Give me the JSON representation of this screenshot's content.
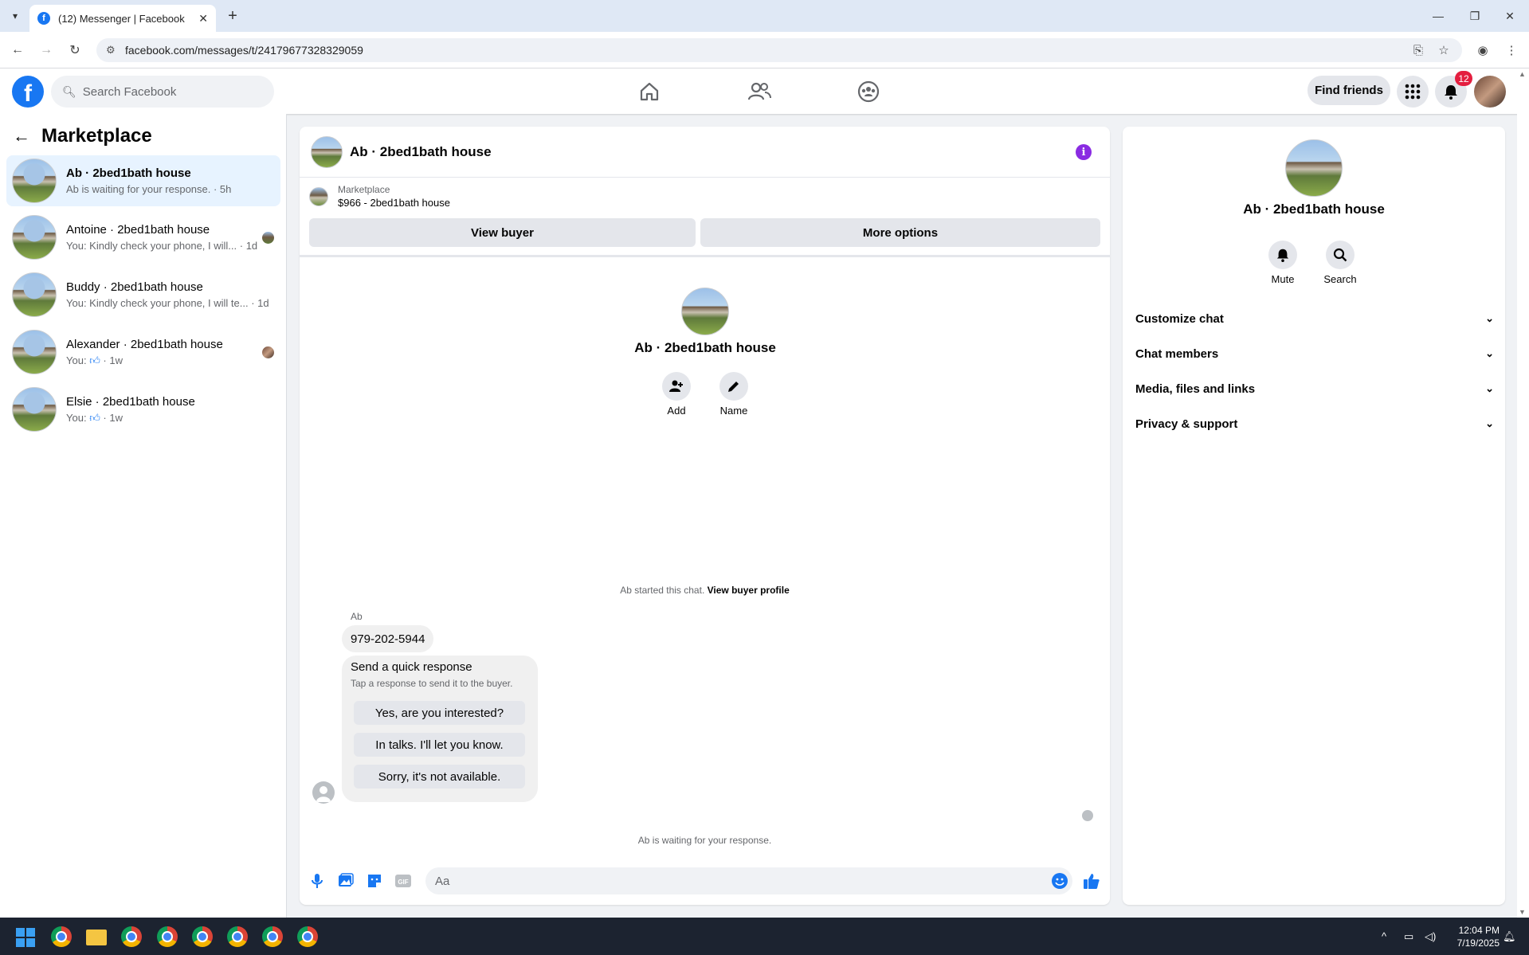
{
  "browser": {
    "tab_title": "(12) Messenger | Facebook",
    "url": "facebook.com/messages/t/24179677328329059"
  },
  "fb_nav": {
    "search_placeholder": "Search Facebook",
    "find_friends": "Find friends",
    "notification_count": "12"
  },
  "left_pane": {
    "title": "Marketplace",
    "chats": [
      {
        "name": "Ab · 2bed1bath house",
        "preview": "Ab is waiting for your response. · 5h"
      },
      {
        "name": "Antoine · 2bed1bath house",
        "preview": "You: Kindly check your phone, I will... · 1d"
      },
      {
        "name": "Buddy · 2bed1bath house",
        "preview": "You: Kindly check your phone, I will te... · 1d"
      },
      {
        "name": "Alexander · 2bed1bath house",
        "preview_prefix": "You:",
        "preview_suffix": "· 1w"
      },
      {
        "name": "Elsie · 2bed1bath house",
        "preview_prefix": "You:",
        "preview_suffix": "· 1w"
      }
    ]
  },
  "conversation": {
    "title": "Ab · 2bed1bath house",
    "marketplace_label": "Marketplace",
    "listing": "$966 - 2bed1bath house",
    "view_buyer": "View buyer",
    "more_options": "More options",
    "profile_name": "Ab · 2bed1bath house",
    "add_label": "Add",
    "name_label": "Name",
    "started_text": "Ab started this chat.",
    "view_buyer_profile": "View buyer profile",
    "sender": "Ab",
    "message": "979-202-5944",
    "quick_response_title": "Send a quick response",
    "quick_response_sub": "Tap a response to send it to the buyer.",
    "quick_responses": [
      "Yes, are you interested?",
      "In talks. I'll let you know.",
      "Sorry, it's not available."
    ],
    "waiting_text": "Ab is waiting for your response.",
    "composer_placeholder": "Aa"
  },
  "right_pane": {
    "name": "Ab · 2bed1bath house",
    "mute": "Mute",
    "search": "Search",
    "sections": [
      "Customize chat",
      "Chat members",
      "Media, files and links",
      "Privacy & support"
    ]
  },
  "taskbar": {
    "time": "12:04 PM",
    "date": "7/19/2025"
  },
  "colors": {
    "brand": "#1877f2",
    "active_chat": "#e7f3ff",
    "info_purple": "#8a2be2"
  }
}
